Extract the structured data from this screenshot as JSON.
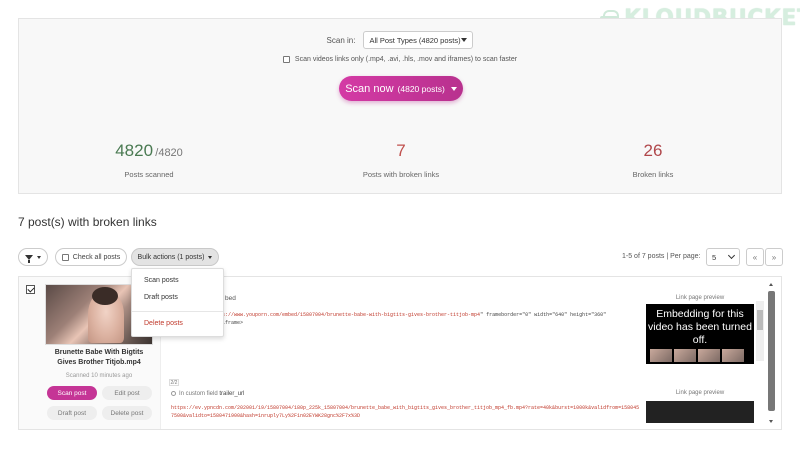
{
  "brand": {
    "logo_text": "KLOUDBUCKET"
  },
  "scan": {
    "scan_in_label": "Scan in:",
    "post_types_value": "All Post Types (4820 posts)",
    "video_option_label": "Scan videos links only (.mp4, .avi, .hls, .mov and iframes) to scan faster",
    "video_option_checked": false,
    "button_label": "Scan now",
    "button_sublabel": "(4820 posts)"
  },
  "stats": {
    "scanned": {
      "value": "4820",
      "total": "/4820",
      "label": "Posts scanned"
    },
    "broken_posts": {
      "value": "7",
      "label": "Posts with broken links"
    },
    "broken_links": {
      "value": "26",
      "label": "Broken links"
    }
  },
  "results": {
    "title": "7 post(s) with broken links",
    "check_all_label": "Check all posts",
    "bulk_actions_label": "Bulk actions (1 posts)",
    "bulk_menu": {
      "scan": "Scan posts",
      "draft": "Draft posts",
      "delete": "Delete posts"
    },
    "pager_info": "1-5 of 7 posts | Per page:",
    "per_page_value": "5",
    "first_label": "«",
    "next_label": "»"
  },
  "post": {
    "title": "Brunette Babe With Bigtits Gives Brother Titjob.mp4",
    "scanned_time": "Scanned 10 minutes ago",
    "checked": true,
    "actions": {
      "scan": "Scan post",
      "edit": "Edit post",
      "draft": "Draft post",
      "delete": "Delete post"
    },
    "field1": {
      "head": "bed",
      "code_url": "https://www.youporn.com/embed/15807004/brunette-babe-with-bigtits-gives-brother-titjob-mp4",
      "code_rest": "\" frameborder=\"0\" width=\"640\" height=\"360\"",
      "code_tail": "llowfullscreen></iframe>",
      "preview_label": "Link page preview",
      "preview_text": "Embedding for this video has been turned off."
    },
    "field_count": "2/2",
    "field2": {
      "head_prefix": "In custom field",
      "field_name": "trailer_url",
      "code": "https://ev.ypncdn.com/202001/19/15807004/180p_225k_15807004/brunette_babe_with_bigtits_gives_brother_titjob_mp4_fb.mp4?rate=40k&burst=1000k&validfrom=1580457500&validto=1580471900&hash=1nruply7Ly%2F1n02EYWK28gnc%2F7x%3D",
      "preview_label": "Link page preview"
    }
  }
}
